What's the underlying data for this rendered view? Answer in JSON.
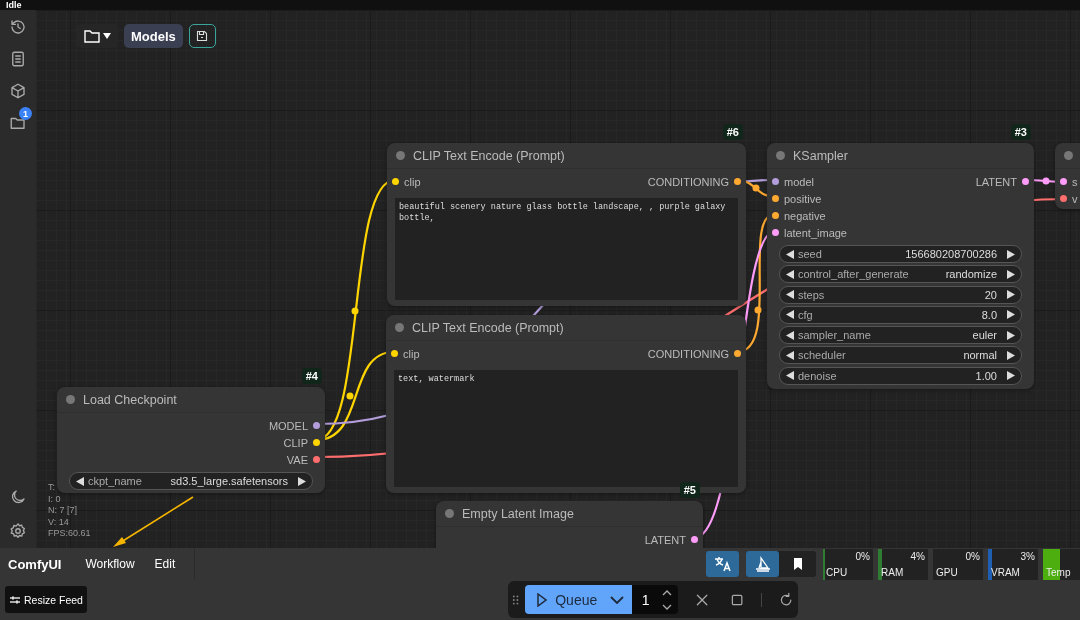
{
  "title_bar": {
    "status": "Idle"
  },
  "sidebar": {
    "badge": "1"
  },
  "toolbar": {
    "models_button": "Models"
  },
  "nodes": [
    {
      "badge": "#6",
      "title": "CLIP Text Encode (Prompt)",
      "inputs": [
        {
          "name": "clip",
          "color": "#ffd500"
        }
      ],
      "outputs": [
        {
          "name": "CONDITIONING",
          "color": "#ffa931"
        }
      ],
      "widgets": [
        {
          "kind": "text",
          "value": "beautiful scenery nature glass bottle landscape, , purple galaxy bottle,"
        }
      ]
    },
    {
      "title": "CLIP Text Encode (Prompt)",
      "inputs": [
        {
          "name": "clip",
          "color": "#ffd500"
        }
      ],
      "outputs": [
        {
          "name": "CONDITIONING",
          "color": "#ffa931"
        }
      ],
      "widgets": [
        {
          "kind": "text",
          "value": "text, watermark"
        }
      ]
    },
    {
      "badge": "#3",
      "title": "KSampler",
      "inputs": [
        {
          "name": "model",
          "color": "#b39ddb"
        },
        {
          "name": "positive",
          "color": "#ffa931"
        },
        {
          "name": "negative",
          "color": "#ffa931"
        },
        {
          "name": "latent_image",
          "color": "#ff9cf9"
        }
      ],
      "outputs": [
        {
          "name": "LATENT",
          "color": "#ff9cf9"
        }
      ],
      "widgets": [
        {
          "kind": "pill",
          "name": "seed",
          "value": "156680208700286"
        },
        {
          "kind": "pill",
          "name": "control_after_generate",
          "value": "randomize"
        },
        {
          "kind": "pill",
          "name": "steps",
          "value": "20"
        },
        {
          "kind": "pill",
          "name": "cfg",
          "value": "8.0"
        },
        {
          "kind": "pill",
          "name": "sampler_name",
          "value": "euler"
        },
        {
          "kind": "pill",
          "name": "scheduler",
          "value": "normal"
        },
        {
          "kind": "pill",
          "name": "denoise",
          "value": "1.00"
        }
      ]
    },
    {
      "badge": "#4",
      "title": "Load Checkpoint",
      "outputs": [
        {
          "name": "MODEL",
          "color": "#b39ddb"
        },
        {
          "name": "CLIP",
          "color": "#ffd500"
        },
        {
          "name": "VAE",
          "color": "#ff6e6e"
        }
      ],
      "widgets": [
        {
          "kind": "pill",
          "name": "ckpt_name",
          "value": "sd3.5_large.safetensors"
        }
      ]
    },
    {
      "badge": "#5",
      "title": "Empty Latent Image",
      "outputs": [
        {
          "name": "LATENT",
          "color": "#ff9cf9"
        }
      ]
    },
    {
      "inputs": [
        {
          "name": "s",
          "color": "#ff9cf9"
        },
        {
          "name": "v",
          "color": "#ff6e6e"
        }
      ]
    }
  ],
  "stats": [
    "T:",
    "I: 0",
    "N: 7 [7]",
    "V: 14",
    "FPS:60.61"
  ],
  "menu": {
    "brand": "ComfyUI",
    "items": [
      "Workflow",
      "Edit"
    ]
  },
  "monitors": [
    {
      "label": "CPU",
      "value": "0%",
      "level": 0,
      "color": "#2e7d32"
    },
    {
      "label": "RAM",
      "value": "4%",
      "level": 0.04,
      "color": "#2e7d32"
    },
    {
      "label": "GPU",
      "value": "0%"
    },
    {
      "label": "VRAM",
      "value": "3%",
      "level": 0.03,
      "color": "#1e5fb4"
    },
    {
      "label": "Temp",
      "level": 0.3,
      "color": "#4caf0f"
    }
  ],
  "resize_button": "Resize Feed",
  "queue": {
    "label": "Queue",
    "count": "1"
  }
}
